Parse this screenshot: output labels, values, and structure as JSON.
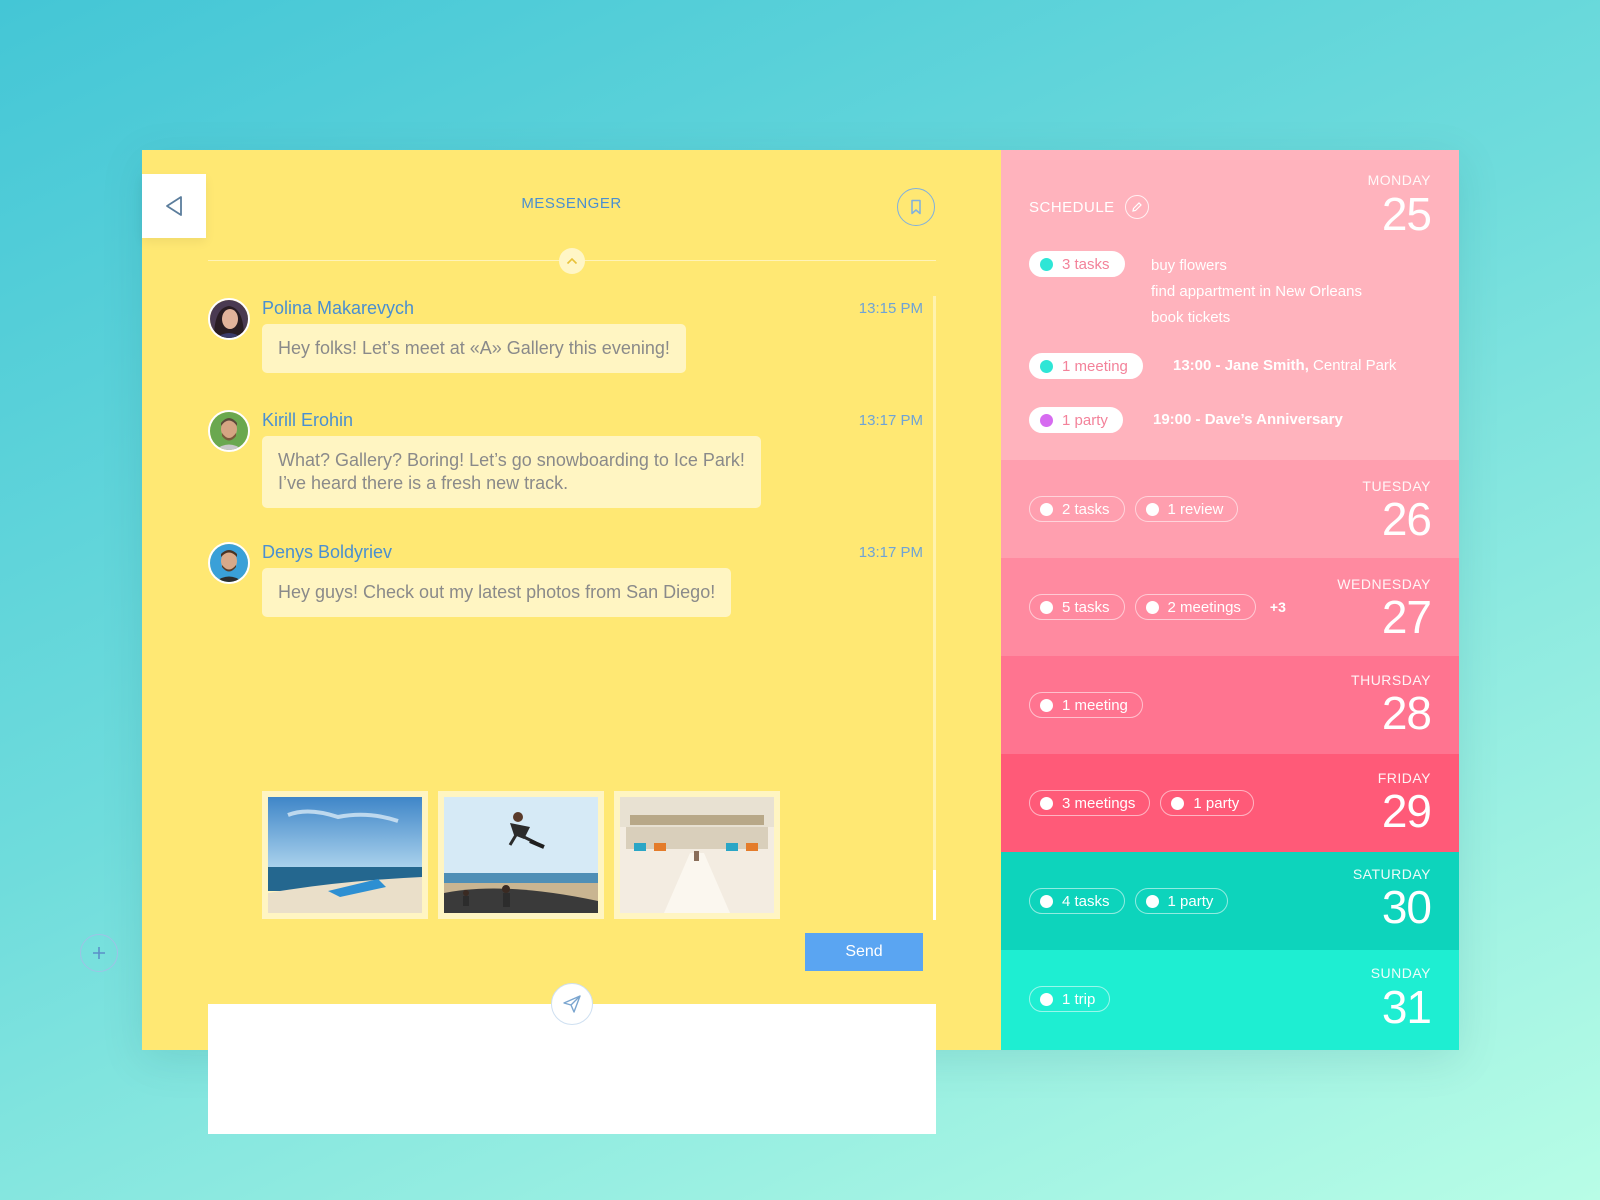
{
  "messenger": {
    "title": "MESSENGER",
    "messages": [
      {
        "sender": "Polina Makarevych",
        "time": "13:15 PM",
        "text": "Hey folks! Let’s meet at «A» Gallery this evening!"
      },
      {
        "sender": "Kirill Erohin",
        "time": "13:17 PM",
        "text_line1": "What? Gallery? Boring! Let’s go snowboarding to Ice Park!",
        "text_line2": "I’ve heard there is a fresh new track."
      },
      {
        "sender": "Denys Boldyriev",
        "time": "13:17 PM",
        "text": "Hey guys! Check out my latest photos from San Diego!"
      }
    ],
    "send_label": "Send"
  },
  "schedule": {
    "title": "SCHEDULE",
    "days": [
      {
        "name": "MONDAY",
        "num": "25",
        "tasks_chip": "3 tasks",
        "tasks": [
          "buy flowers",
          "find appartment in New Orleans",
          "book tickets"
        ],
        "meeting_chip": "1 meeting",
        "meeting_time": "13:00 - Jane Smith,",
        "meeting_place": " Central Park",
        "party_chip": "1 party",
        "party_event": "19:00 - Dave’s Anniversary"
      },
      {
        "name": "TUESDAY",
        "num": "26",
        "chips": [
          "2 tasks",
          "1 review"
        ]
      },
      {
        "name": "WEDNESDAY",
        "num": "27",
        "chips": [
          "5 tasks",
          "2 meetings"
        ],
        "more": "+3"
      },
      {
        "name": "THURSDAY",
        "num": "28",
        "chips": [
          "1 meeting"
        ]
      },
      {
        "name": "FRIDAY",
        "num": "29",
        "chips": [
          "3 meetings",
          "1 party"
        ]
      },
      {
        "name": "SATURDAY",
        "num": "30",
        "chips": [
          "4 tasks",
          "1 party"
        ]
      },
      {
        "name": "SUNDAY",
        "num": "31",
        "chips": [
          "1 trip"
        ]
      }
    ]
  },
  "colors": {
    "messenger_bg": "#ffe873",
    "accent_blue": "#4a8fd1",
    "send_button": "#5aa5f2",
    "monday": "#ffb3bd",
    "tuesday": "#ff9faf",
    "wednesday": "#ff8aa0",
    "thursday": "#ff7490",
    "friday": "#ff5a78",
    "saturday": "#0dd4bc",
    "sunday": "#1eeed2",
    "dot_cyan": "#2ee6d6",
    "dot_purple": "#d66bf0"
  }
}
